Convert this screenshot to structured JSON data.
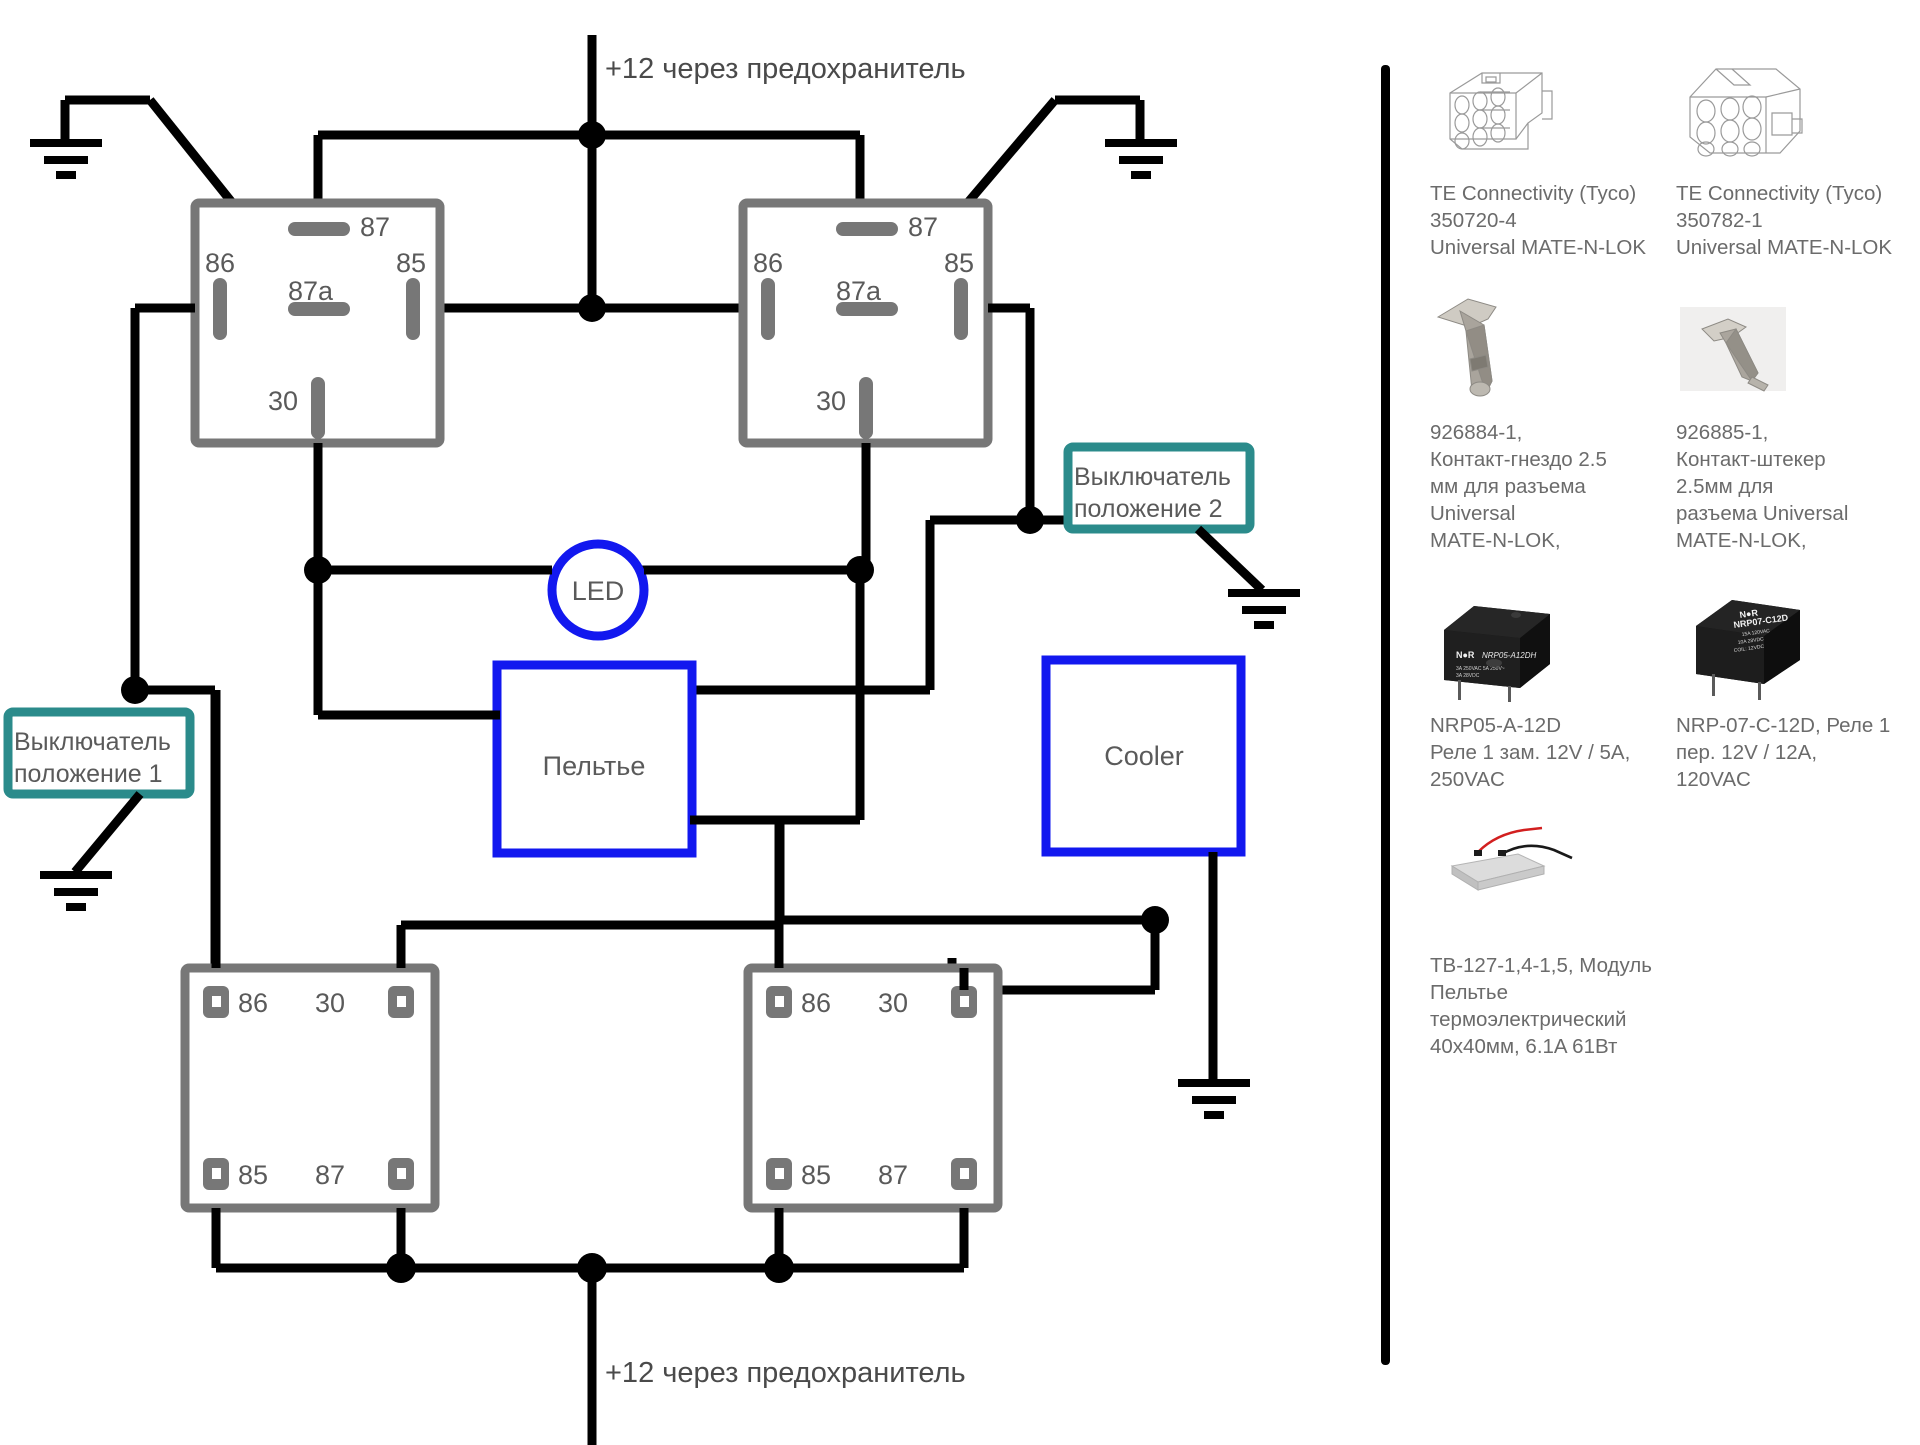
{
  "diagram": {
    "title_top": "+12 через предохранитель",
    "title_bottom": "+12 через предохранитель",
    "automotive_relay_left": {
      "name": "relay-left",
      "pins": {
        "p87": "87",
        "p87a": "87a",
        "p86": "86",
        "p85": "85",
        "p30": "30"
      }
    },
    "automotive_relay_right": {
      "name": "relay-right",
      "pins": {
        "p87": "87",
        "p87a": "87a",
        "p86": "86",
        "p85": "85",
        "p30": "30"
      }
    },
    "pcb_relay_left": {
      "pins": {
        "p86": "86",
        "p30": "30",
        "p85": "85",
        "p87": "87"
      }
    },
    "pcb_relay_right": {
      "pins": {
        "p86": "86",
        "p30": "30",
        "p85": "85",
        "p87": "87"
      }
    },
    "led_label": "LED",
    "peltier_label": "Пельтье",
    "cooler_label": "Cooler",
    "switch_1": "Выключатель\nположение 1",
    "switch_1_line1": "Выключатель",
    "switch_1_line2": "положение 1",
    "switch_2_line1": "Выключатель",
    "switch_2_line2": "положение 2",
    "colors": {
      "wire": "#000000",
      "relay_body": "#777777",
      "blue_component": "#1218ef",
      "teal_switch": "#2b8b8b",
      "text": "#5a5a5a"
    }
  },
  "parts": [
    {
      "icon": "connector-receptacle-9way-icon",
      "caption": "TE Connectivity (Tyco)\n350720-4\nUniversal MATE-N-LOK"
    },
    {
      "icon": "connector-plug-9way-icon",
      "caption": "TE Connectivity (Tyco)\n350782-1\nUniversal MATE-N-LOK"
    },
    {
      "icon": "contact-socket-icon",
      "caption": "926884-1,\nКонтакт-гнездо 2.5\nмм для разъема\nUniversal\nMATE-N-LOK,"
    },
    {
      "icon": "contact-pin-icon",
      "caption": "926885-1,\nКонтакт-штекер\n2.5мм для\nразъема Universal\nMATE-N-LOK,"
    },
    {
      "icon": "relay-nrp05-icon",
      "caption": "NRP05-A-12D\nРеле 1 зам. 12V / 5A,\n250VAC"
    },
    {
      "icon": "relay-nrp07-icon",
      "caption": "NRP-07-C-12D, Реле 1\nпер. 12V / 12A,\n120VAC"
    },
    {
      "icon": "peltier-module-icon",
      "caption": "TB-127-1,4-1,5, Модуль\nПельтье\nтермоэлектрический\n40x40мм, 6.1A 61Вт"
    }
  ]
}
